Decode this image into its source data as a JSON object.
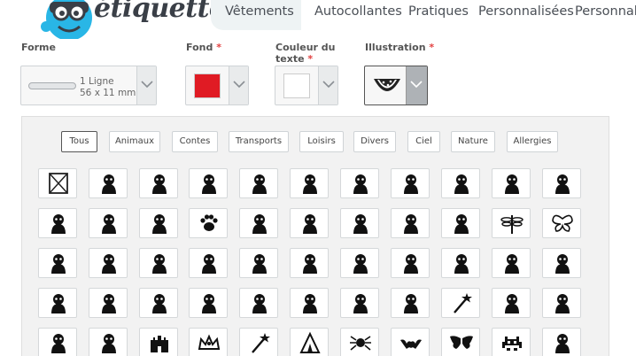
{
  "header": {
    "logo_text": "étiquette!",
    "nav": [
      "Vêtements",
      "Autocollantes",
      "Pratiques",
      "Personnalisées",
      "Personnalis"
    ]
  },
  "selectors": {
    "forme": {
      "label": "Forme",
      "value_line1": "1 Ligne",
      "value_line2": "56 x 11 mm"
    },
    "fond": {
      "label": "Fond",
      "required": "*",
      "color": "#e01b24"
    },
    "couleur": {
      "label_line1": "Couleur du",
      "label_line2": "texte",
      "required": "*",
      "color": "#ffffff"
    },
    "illustration": {
      "label": "Illustration",
      "required": "*",
      "icon": "watermelon-icon"
    }
  },
  "filters": {
    "items": [
      "Tous",
      "Animaux",
      "Contes",
      "Transports",
      "Loisirs",
      "Divers",
      "Ciel",
      "Nature",
      "Allergies"
    ],
    "active": "Tous"
  },
  "icons": [
    [
      "none-icon",
      "cat-icon",
      "dog-icon",
      "hedgehog-icon",
      "fox-icon",
      "rabbit-icon",
      "panda-icon",
      "teddy-bear-icon",
      "horse-icon",
      "deer-icon",
      "sheep-icon"
    ],
    [
      "tiger-icon",
      "lion-icon",
      "hippo-icon",
      "paw-icon",
      "elephant-icon",
      "toucan-icon",
      "bird-icon",
      "chick-icon",
      "owl-icon",
      "dragonfly-icon",
      "butterfly-icon"
    ],
    [
      "turtle-icon",
      "whale-icon",
      "dolphin-icon",
      "penguin-icon",
      "shark-icon",
      "fish-icon",
      "seahorse-icon",
      "dinosaur-icon",
      "brontosaurus-icon",
      "unicorn-icon",
      "pirate-girl-icon"
    ],
    [
      "knight-icon",
      "kid-icon",
      "pirate-icon",
      "princess-icon",
      "mermaid-icon",
      "superhero-icon",
      "superhero-flying-icon",
      "fairy-icon",
      "fairy-wand-icon",
      "ballerina-icon",
      "robot-icon"
    ],
    [
      "monster-icon",
      "carriage-icon",
      "castle-icon",
      "tiara-icon",
      "magic-wand-icon",
      "teepee-icon",
      "spider-icon",
      "bat-icon",
      "wings-icon",
      "space-invader-icon",
      "skull-icon"
    ]
  ]
}
